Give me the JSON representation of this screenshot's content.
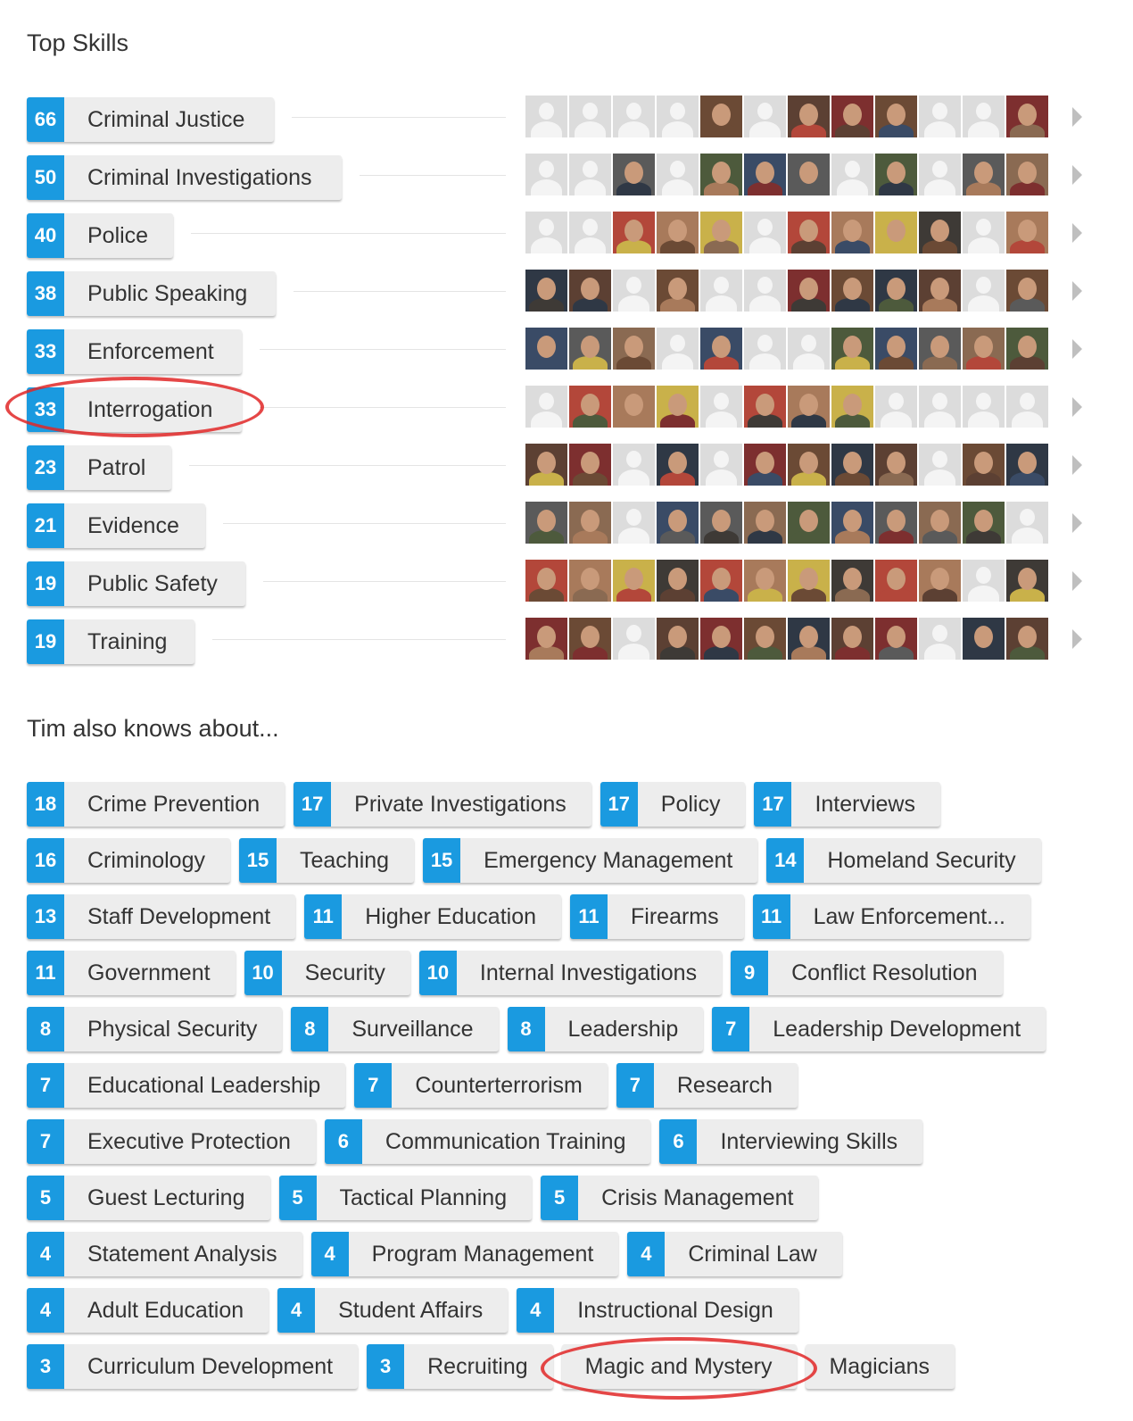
{
  "top_skills_title": "Top Skills",
  "also_knows_title": "Tim also knows about...",
  "top_skills": [
    {
      "count": "66",
      "name": "Criminal Justice"
    },
    {
      "count": "50",
      "name": "Criminal Investigations"
    },
    {
      "count": "40",
      "name": "Police"
    },
    {
      "count": "38",
      "name": "Public Speaking"
    },
    {
      "count": "33",
      "name": "Enforcement"
    },
    {
      "count": "33",
      "name": "Interrogation"
    },
    {
      "count": "23",
      "name": "Patrol"
    },
    {
      "count": "21",
      "name": "Evidence"
    },
    {
      "count": "19",
      "name": "Public Safety"
    },
    {
      "count": "19",
      "name": "Training"
    }
  ],
  "endorser_rows": [
    "BBBBPBPPPBBP",
    "BBPBPPPBPBPP",
    "BBPPPBPPPPBP",
    "PPBPBBPPPPBP",
    "PPPBPBBPPPPP",
    "BPPPBPPPBBBB",
    "PPBPBPPPPBPP",
    "PPBPPPPPPPPB",
    "PPPPPPPPPPBP",
    "PPBPPPPPPBPP"
  ],
  "photo_palette": [
    "#6b4a35",
    "#3e3a36",
    "#8a6a52",
    "#2f3845",
    "#b3473a",
    "#4d5a3c",
    "#5c4033",
    "#a87a5b",
    "#3a4b66",
    "#7d2f2f",
    "#c9b14a",
    "#5a5a5a"
  ],
  "other_skills": [
    [
      {
        "count": "18",
        "name": "Crime Prevention"
      },
      {
        "count": "17",
        "name": "Private Investigations"
      },
      {
        "count": "17",
        "name": "Policy"
      },
      {
        "count": "17",
        "name": "Interviews"
      }
    ],
    [
      {
        "count": "16",
        "name": "Criminology"
      },
      {
        "count": "15",
        "name": "Teaching"
      },
      {
        "count": "15",
        "name": "Emergency Management"
      },
      {
        "count": "14",
        "name": "Homeland Security"
      }
    ],
    [
      {
        "count": "13",
        "name": "Staff Development"
      },
      {
        "count": "11",
        "name": "Higher Education"
      },
      {
        "count": "11",
        "name": "Firearms"
      },
      {
        "count": "11",
        "name": "Law Enforcement..."
      }
    ],
    [
      {
        "count": "11",
        "name": "Government"
      },
      {
        "count": "10",
        "name": "Security"
      },
      {
        "count": "10",
        "name": "Internal Investigations"
      },
      {
        "count": "9",
        "name": "Conflict Resolution"
      }
    ],
    [
      {
        "count": "8",
        "name": "Physical Security"
      },
      {
        "count": "8",
        "name": "Surveillance"
      },
      {
        "count": "8",
        "name": "Leadership"
      },
      {
        "count": "7",
        "name": "Leadership Development"
      }
    ],
    [
      {
        "count": "7",
        "name": "Educational Leadership"
      },
      {
        "count": "7",
        "name": "Counterterrorism"
      },
      {
        "count": "7",
        "name": "Research"
      }
    ],
    [
      {
        "count": "7",
        "name": "Executive Protection"
      },
      {
        "count": "6",
        "name": "Communication Training"
      },
      {
        "count": "6",
        "name": "Interviewing Skills"
      }
    ],
    [
      {
        "count": "5",
        "name": "Guest Lecturing"
      },
      {
        "count": "5",
        "name": "Tactical Planning"
      },
      {
        "count": "5",
        "name": "Crisis Management"
      }
    ],
    [
      {
        "count": "4",
        "name": "Statement Analysis"
      },
      {
        "count": "4",
        "name": "Program Management"
      },
      {
        "count": "4",
        "name": "Criminal Law"
      }
    ],
    [
      {
        "count": "4",
        "name": "Adult Education"
      },
      {
        "count": "4",
        "name": "Student Affairs"
      },
      {
        "count": "4",
        "name": "Instructional Design"
      }
    ],
    [
      {
        "count": "3",
        "name": "Curriculum Development"
      },
      {
        "count": "3",
        "name": "Recruiting"
      },
      {
        "count": "",
        "name": "Magic and Mystery"
      },
      {
        "count": "",
        "name": "Magicians"
      }
    ]
  ],
  "highlight_color": "#e02727",
  "accent_color": "#1a9ae0"
}
